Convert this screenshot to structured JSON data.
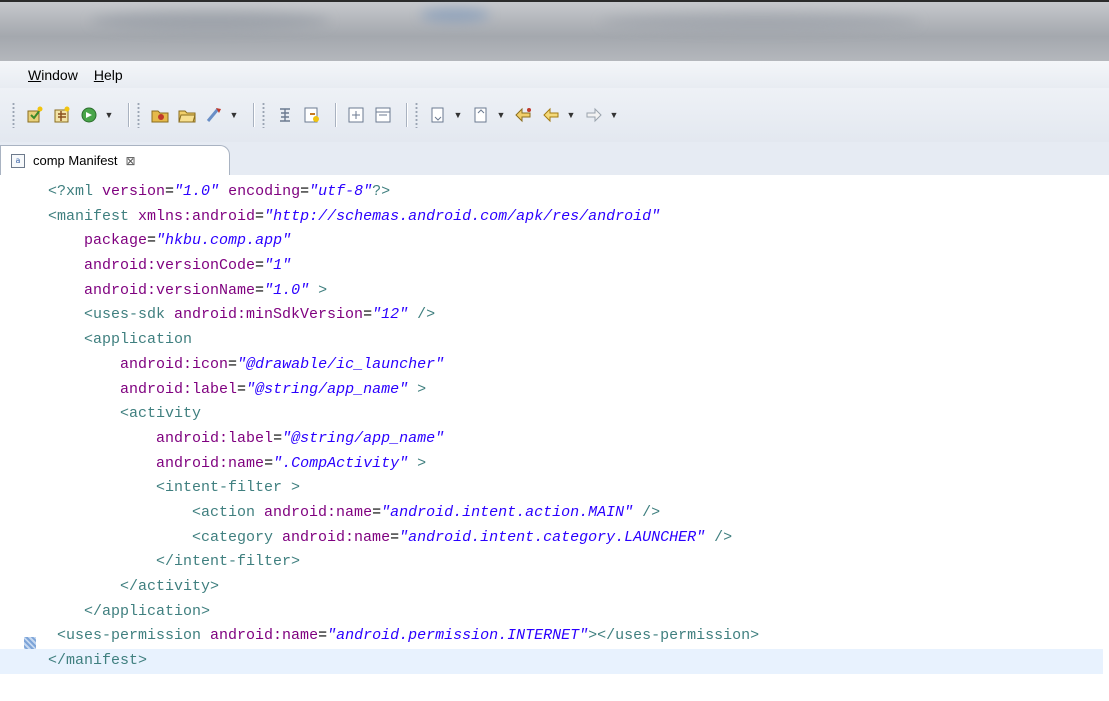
{
  "menu": {
    "items": [
      {
        "mnemonic": "W",
        "rest": "indow"
      },
      {
        "mnemonic": "H",
        "rest": "elp"
      }
    ]
  },
  "toolbar": {
    "icons": [
      "new-android-project-icon",
      "new-android-xml-icon",
      "run-icon",
      "open-type-icon",
      "open-folder-icon",
      "run-config-icon",
      "toggle-annotation-icon",
      "toggle-markup-icon",
      "expand-all-icon",
      "collapse-all-icon",
      "next-annotation-icon",
      "prev-annotation-icon",
      "last-edit-icon",
      "back-icon",
      "forward-icon"
    ]
  },
  "editor_tab": {
    "label": "comp Manifest",
    "close_glyph": "⊠"
  },
  "code_lines": [
    {
      "indent": "",
      "parts": [
        [
          "tag",
          "<?xml "
        ],
        [
          "attr",
          "version"
        ],
        [
          "eq",
          "="
        ],
        [
          "val",
          "\"1.0\""
        ],
        [
          "tag",
          " "
        ],
        [
          "attr",
          "encoding"
        ],
        [
          "eq",
          "="
        ],
        [
          "val",
          "\"utf-8\""
        ],
        [
          "tag",
          "?>"
        ]
      ]
    },
    {
      "indent": "",
      "parts": [
        [
          "tag",
          "<manifest "
        ],
        [
          "attr",
          "xmlns:android"
        ],
        [
          "eq",
          "="
        ],
        [
          "val",
          "\"http://schemas.android.com/apk/res/android\""
        ]
      ]
    },
    {
      "indent": "    ",
      "parts": [
        [
          "attr",
          "package"
        ],
        [
          "eq",
          "="
        ],
        [
          "val",
          "\"hkbu.comp.app\""
        ]
      ]
    },
    {
      "indent": "    ",
      "parts": [
        [
          "attr",
          "android:versionCode"
        ],
        [
          "eq",
          "="
        ],
        [
          "val",
          "\"1\""
        ]
      ]
    },
    {
      "indent": "    ",
      "parts": [
        [
          "attr",
          "android:versionName"
        ],
        [
          "eq",
          "="
        ],
        [
          "val",
          "\"1.0\""
        ],
        [
          "tag",
          " >"
        ]
      ]
    },
    {
      "indent": "    ",
      "parts": [
        [
          "tag",
          "<uses-sdk "
        ],
        [
          "attr",
          "android:minSdkVersion"
        ],
        [
          "eq",
          "="
        ],
        [
          "val",
          "\"12\""
        ],
        [
          "tag",
          " />"
        ]
      ]
    },
    {
      "indent": "    ",
      "parts": [
        [
          "tag",
          "<application"
        ]
      ]
    },
    {
      "indent": "        ",
      "parts": [
        [
          "attr",
          "android:icon"
        ],
        [
          "eq",
          "="
        ],
        [
          "val",
          "\"@drawable/ic_launcher\""
        ]
      ]
    },
    {
      "indent": "        ",
      "parts": [
        [
          "attr",
          "android:label"
        ],
        [
          "eq",
          "="
        ],
        [
          "val",
          "\"@string/app_name\""
        ],
        [
          "tag",
          " >"
        ]
      ]
    },
    {
      "indent": "        ",
      "parts": [
        [
          "tag",
          "<activity"
        ]
      ]
    },
    {
      "indent": "            ",
      "parts": [
        [
          "attr",
          "android:label"
        ],
        [
          "eq",
          "="
        ],
        [
          "val",
          "\"@string/app_name\""
        ]
      ]
    },
    {
      "indent": "            ",
      "parts": [
        [
          "attr",
          "android:name"
        ],
        [
          "eq",
          "="
        ],
        [
          "val",
          "\".CompActivity\""
        ],
        [
          "tag",
          " >"
        ]
      ]
    },
    {
      "indent": "            ",
      "parts": [
        [
          "tag",
          "<intent-filter >"
        ]
      ]
    },
    {
      "indent": "                ",
      "parts": [
        [
          "tag",
          "<action "
        ],
        [
          "attr",
          "android:name"
        ],
        [
          "eq",
          "="
        ],
        [
          "val",
          "\"android.intent.action.MAIN\""
        ],
        [
          "tag",
          " />"
        ]
      ]
    },
    {
      "indent": "                ",
      "parts": [
        [
          "tag",
          "<category "
        ],
        [
          "attr",
          "android:name"
        ],
        [
          "eq",
          "="
        ],
        [
          "val",
          "\"android.intent.category.LAUNCHER\""
        ],
        [
          "tag",
          " />"
        ]
      ]
    },
    {
      "indent": "            ",
      "parts": [
        [
          "tag",
          "</intent-filter>"
        ]
      ]
    },
    {
      "indent": "        ",
      "parts": [
        [
          "tag",
          "</activity>"
        ]
      ]
    },
    {
      "indent": "    ",
      "parts": [
        [
          "tag",
          "</application>"
        ]
      ]
    },
    {
      "indent": " ",
      "parts": [
        [
          "tag",
          "<uses-permission "
        ],
        [
          "attr",
          "android:name"
        ],
        [
          "eq",
          "="
        ],
        [
          "val",
          "\"android.permission.INTERNET\""
        ],
        [
          "tag",
          "></uses-permission>"
        ]
      ]
    },
    {
      "indent": "",
      "parts": [
        [
          "tag",
          "</manifest>"
        ]
      ],
      "current": true
    }
  ]
}
